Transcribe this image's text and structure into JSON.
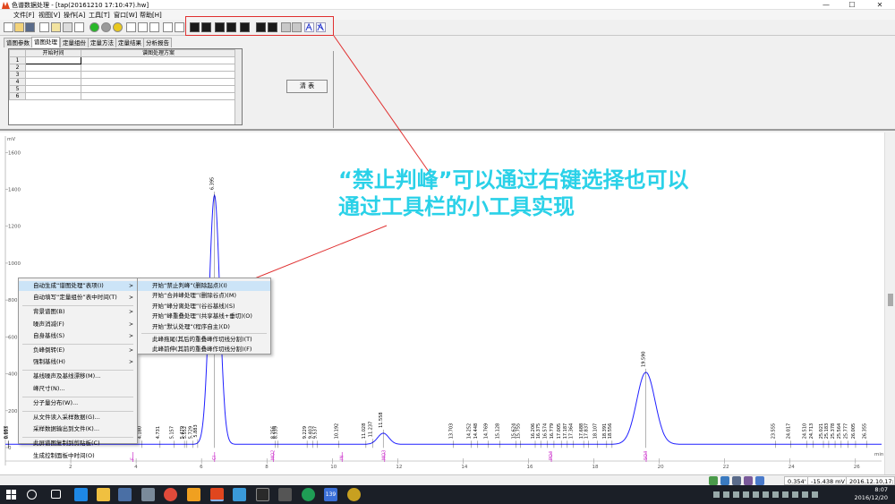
{
  "window": {
    "title": "色谱数据处理 - [tap(20161210 17:10:47).hw]",
    "minimize": "—",
    "maximize": "☐",
    "close": "✕"
  },
  "menubar": {
    "items": [
      "文件[F]",
      "视图[V]",
      "操作[A]",
      "工具[T]",
      "窗口[W]",
      "帮助[H]"
    ]
  },
  "tabs": [
    "谱图参数",
    "谱图处理",
    "定量组份",
    "定量方法",
    "定量结果",
    "分析报告"
  ],
  "active_tab": 1,
  "table": {
    "headers": [
      "开始时间",
      "谱图处理方案"
    ],
    "rows": [
      "1",
      "2",
      "3",
      "4",
      "5",
      "6"
    ]
  },
  "clear_button": "清  表",
  "annotation": {
    "line1": "“禁止判峰”可以通过右键选择也可以",
    "line2": "通过工具栏的小工具实现"
  },
  "context_menu": {
    "items": [
      {
        "label": "自动生成“谱图处理”表项(I)",
        "arrow": ">",
        "highlight": true
      },
      {
        "label": "自动填写“定量组份”表中时间(T)",
        "arrow": ">"
      },
      {
        "sep": true
      },
      {
        "label": "背景谱图(B)",
        "arrow": ">"
      },
      {
        "label": "噪声消减(F)",
        "arrow": ">"
      },
      {
        "label": "自身基线(S)",
        "arrow": ">"
      },
      {
        "sep": true
      },
      {
        "label": "负峰倒转(E)",
        "arrow": ">"
      },
      {
        "label": "强制基线(H)",
        "arrow": ">"
      },
      {
        "sep": true
      },
      {
        "label": "基线噪声及基线漂移(M)..."
      },
      {
        "label": "峰尺寸(N)..."
      },
      {
        "sep": true
      },
      {
        "label": "分子量分布(W)..."
      },
      {
        "sep": true
      },
      {
        "label": "从文件读入采样数据(G)..."
      },
      {
        "label": "采样数据输出到文件(K)..."
      },
      {
        "sep": true
      },
      {
        "label": "此屏谱图复制到剪贴板(C)"
      },
      {
        "label": "生成控制面板中时间(O)"
      }
    ]
  },
  "submenu": {
    "items": [
      {
        "label": "开始“禁止判峰”(删除起点)(I)",
        "highlight": true
      },
      {
        "label": "开始“合并峰处理”(删除谷点)(M)"
      },
      {
        "label": "开始“峰分离处理”(谷谷基线)(S)"
      },
      {
        "label": "开始“峰重叠处理”(共享基线+垂切)(O)"
      },
      {
        "label": "开始“默认处理”(程序自主)(D)"
      },
      {
        "sep": true
      },
      {
        "label": "此峰拖尾(其后的重叠峰作切线分割)(T)"
      },
      {
        "label": "此峰前伸(其前的重叠峰作切线分割)(F)"
      }
    ]
  },
  "chart_data": {
    "type": "line",
    "ylabel": "mV",
    "xlabel": "min",
    "y_ticks": [
      0,
      200,
      400,
      600,
      800,
      1000,
      1200,
      1400,
      1600
    ],
    "x_ticks": [
      2,
      4,
      6,
      8,
      10,
      12,
      14,
      16,
      18,
      20,
      22,
      24,
      26
    ],
    "xlim": [
      0,
      26.8
    ],
    "ylim": [
      0,
      1650
    ],
    "peaks": [
      {
        "rt": 6.395,
        "height": 1350,
        "width": 0.16
      },
      {
        "rt": 11.558,
        "height": 60,
        "width": 0.17
      },
      {
        "rt": 19.59,
        "height": 390,
        "width": 0.28
      }
    ],
    "peak_labels": [
      {
        "rt": 0.087,
        "label": "0.087"
      },
      {
        "rt": 0.103,
        "label": "0.103"
      },
      {
        "rt": 4.18,
        "label": "4.180"
      },
      {
        "rt": 4.731,
        "label": "4.731"
      },
      {
        "rt": 5.157,
        "label": "5.157"
      },
      {
        "rt": 5.479,
        "label": "5.479"
      },
      {
        "rt": 5.552,
        "label": "5.552"
      },
      {
        "rt": 5.729,
        "label": "5.729"
      },
      {
        "rt": 5.883,
        "label": "5.883"
      },
      {
        "rt": 6.395,
        "label": "6.395"
      },
      {
        "rt": 8.256,
        "label": "8.256"
      },
      {
        "rt": 8.339,
        "label": "8.339"
      },
      {
        "rt": 9.229,
        "label": "9.229"
      },
      {
        "rt": 9.403,
        "label": "9.403"
      },
      {
        "rt": 9.537,
        "label": "9.537"
      },
      {
        "rt": 10.192,
        "label": "10.192"
      },
      {
        "rt": 11.028,
        "label": "11.028"
      },
      {
        "rt": 11.237,
        "label": "11.237"
      },
      {
        "rt": 11.558,
        "label": "11.558"
      },
      {
        "rt": 13.703,
        "label": "13.703"
      },
      {
        "rt": 14.252,
        "label": "14.252"
      },
      {
        "rt": 14.448,
        "label": "14.448"
      },
      {
        "rt": 14.769,
        "label": "14.769"
      },
      {
        "rt": 15.128,
        "label": "15.128"
      },
      {
        "rt": 15.624,
        "label": "15.624"
      },
      {
        "rt": 15.755,
        "label": "15.755"
      },
      {
        "rt": 16.206,
        "label": "16.206"
      },
      {
        "rt": 16.375,
        "label": "16.375"
      },
      {
        "rt": 16.574,
        "label": "16.574"
      },
      {
        "rt": 16.779,
        "label": "16.779"
      },
      {
        "rt": 17.005,
        "label": "17.005"
      },
      {
        "rt": 17.187,
        "label": "17.187"
      },
      {
        "rt": 17.364,
        "label": "17.364"
      },
      {
        "rt": 17.688,
        "label": "17.688"
      },
      {
        "rt": 17.837,
        "label": "17.837"
      },
      {
        "rt": 18.107,
        "label": "18.107"
      },
      {
        "rt": 18.391,
        "label": "18.391"
      },
      {
        "rt": 18.556,
        "label": "18.556"
      },
      {
        "rt": 19.59,
        "label": "19.590"
      },
      {
        "rt": 23.555,
        "label": "23.555"
      },
      {
        "rt": 24.017,
        "label": "24.017"
      },
      {
        "rt": 24.51,
        "label": "24.510"
      },
      {
        "rt": 24.713,
        "label": "24.713"
      },
      {
        "rt": 25.021,
        "label": "25.021"
      },
      {
        "rt": 25.183,
        "label": "25.183"
      },
      {
        "rt": 25.378,
        "label": "25.378"
      },
      {
        "rt": 25.564,
        "label": "25.564"
      },
      {
        "rt": 25.777,
        "label": "25.777"
      },
      {
        "rt": 26.005,
        "label": "26.005"
      },
      {
        "rt": 26.355,
        "label": "26.355"
      }
    ],
    "event_markers": [
      {
        "rt": 3.9,
        "label": "F"
      },
      {
        "rt": 6.4,
        "label": "CI"
      },
      {
        "rt": 8.2,
        "label": "MO2"
      },
      {
        "rt": 10.3,
        "label": "IN"
      },
      {
        "rt": 11.6,
        "label": "MO3"
      },
      {
        "rt": 16.7,
        "label": "PO4"
      },
      {
        "rt": 19.6,
        "label": "SO4"
      }
    ],
    "trace_color": "#2020ff",
    "label_color": "#000000",
    "marker_color": "#cc33cc"
  },
  "statusbar": {
    "coord_time": "0.354'",
    "coord_mv": "-15.438 mV",
    "timestamp": "2016.12.10,17:10:47"
  },
  "taskbar": {
    "time": "8:07",
    "date": "2016/12/20",
    "badge": "139"
  }
}
